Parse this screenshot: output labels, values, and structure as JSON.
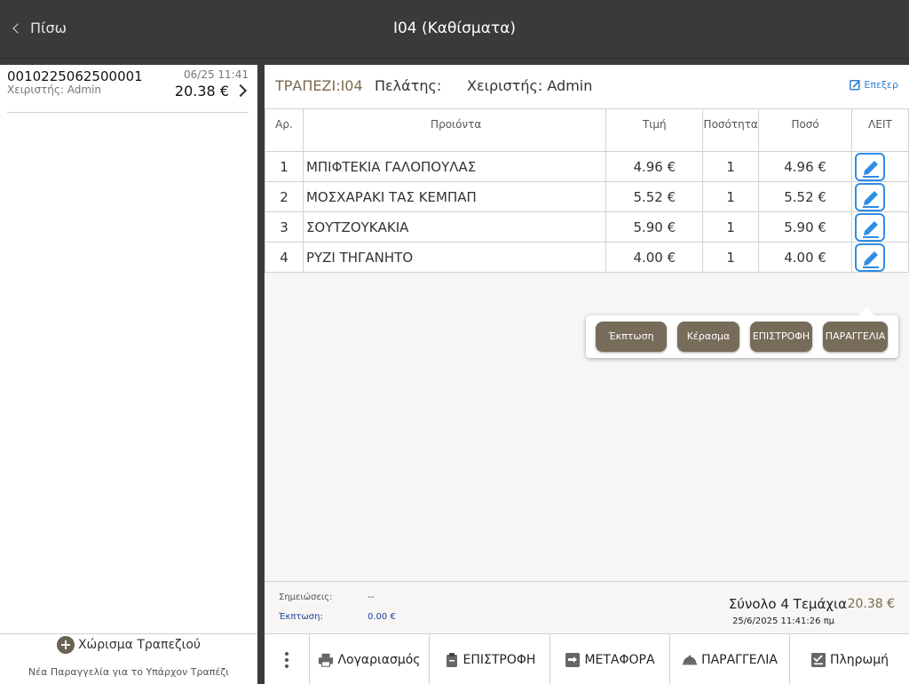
{
  "header": {
    "back_label": "Πίσω",
    "title": "I04 (Καθίσματα)"
  },
  "left": {
    "order": {
      "id": "0010225062500001",
      "date": "06/25 11:41",
      "operator": "Χειριστής: Admin",
      "total": "20.38 €"
    },
    "split_label": "Χώρισμα Τραπεζιού",
    "new_order_label": "Νέα Παραγγελία για το Υπάρχον Τραπέζι"
  },
  "info": {
    "table": "ΤΡΑΠΕΖΙ:I04",
    "customer_label": "Πελάτης:",
    "operator": "Χειριστής: Admin",
    "edit_label": "Επεξερ"
  },
  "columns": {
    "no": "Αρ.",
    "product": "Προιόντα",
    "price": "Τιμή",
    "qty": "Ποσότητα",
    "amount": "Ποσό",
    "action": "ΛΕΙΤ"
  },
  "rows": [
    {
      "no": "1",
      "product": "ΜΠΙΦΤΕΚΙΑ ΓΑΛΟΠΟΥΛΑΣ",
      "price": "4.96 €",
      "qty": "1",
      "amount": "4.96 €"
    },
    {
      "no": "2",
      "product": "ΜΟΣΧΑΡΑΚΙ ΤΑΣ ΚΕΜΠΑΠ",
      "price": "5.52 €",
      "qty": "1",
      "amount": "5.52 €"
    },
    {
      "no": "3",
      "product": "ΣΟΥΤΖΟΥΚΑΚΙΑ",
      "price": "5.90 €",
      "qty": "1",
      "amount": "5.90 €"
    },
    {
      "no": "4",
      "product": "ΡΥΖΙ ΤΗΓΑΝΗΤΟ",
      "price": "4.00 €",
      "qty": "1",
      "amount": "4.00 €"
    }
  ],
  "popup": {
    "discount": "Έκπτωση",
    "treat": "Κέρασμα",
    "return": "ΕΠΙΣΤΡΟΦΗ",
    "order": "ΠΑΡΑΓΓΕΛΙΑ"
  },
  "summary": {
    "notes_label": "Σημειώσεις:",
    "notes_value": "--",
    "discount_label": "Έκπτωση:",
    "discount_value": "0.00 €",
    "total_label": "Σύνολο 4 Τεμάχια",
    "total_value": "20.38 €",
    "timestamp": "25/6/2025 11:41:26 πμ"
  },
  "toolbar": {
    "bill": "Λογαριασμός",
    "return": "ΕΠΙΣΤΡΟΦΗ",
    "transfer": "ΜΕΤΑΦΟΡΑ",
    "order": "ΠΑΡΑΓΓΕΛΙΑ",
    "payment": "Πληρωμή"
  },
  "colors": {
    "topbar": "#3a3a3a",
    "accent_brown": "#776b5a",
    "edit_blue": "#2f8de4"
  }
}
